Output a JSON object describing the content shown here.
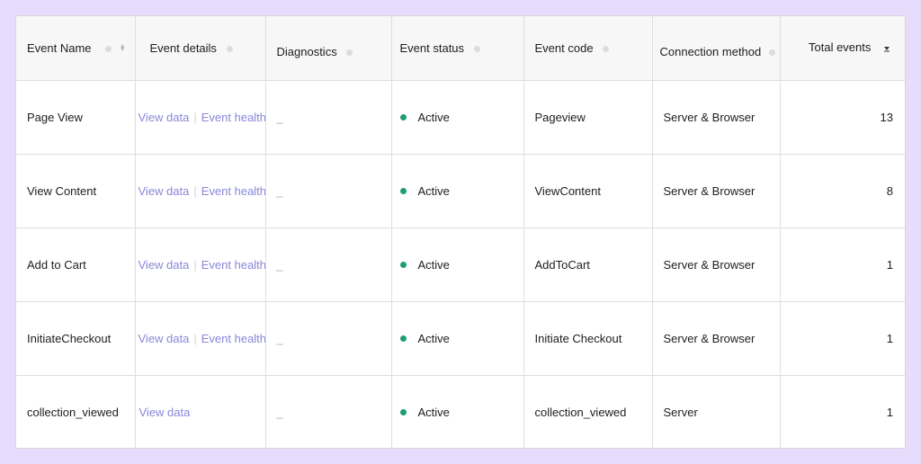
{
  "columns": {
    "event_name": "Event Name",
    "event_details": "Event details",
    "diagnostics": "Diagnostics",
    "event_status": "Event status",
    "event_code": "Event code",
    "connection_method": "Connection method",
    "total_events": "Total events"
  },
  "colors": {
    "page_background": "#e7dcfb",
    "link": "#8a87d9",
    "status_active": "#1f9e6e"
  },
  "rows": [
    {
      "name": "Page View",
      "view_data": "View data",
      "event_health": "Event health",
      "diagnostics": "_",
      "status": "Active",
      "code": "Pageview",
      "method": "Server & Browser",
      "total": "13"
    },
    {
      "name": "View Content",
      "view_data": "View data",
      "event_health": "Event health",
      "diagnostics": "_",
      "status": "Active",
      "code": "ViewContent",
      "method": "Server & Browser",
      "total": "8"
    },
    {
      "name": "Add to Cart",
      "view_data": "View data",
      "event_health": "Event health",
      "diagnostics": "_",
      "status": "Active",
      "code": "AddToCart",
      "method": "Server & Browser",
      "total": "1"
    },
    {
      "name": "InitiateCheckout",
      "view_data": "View data",
      "event_health": "Event health",
      "diagnostics": "_",
      "status": "Active",
      "code": "Initiate Checkout",
      "method": "Server & Browser",
      "total": "1"
    },
    {
      "name": "collection_viewed",
      "view_data": "View data",
      "diagnostics": "_",
      "status": "Active",
      "code": "collection_viewed",
      "method": "Server",
      "total": "1"
    }
  ]
}
